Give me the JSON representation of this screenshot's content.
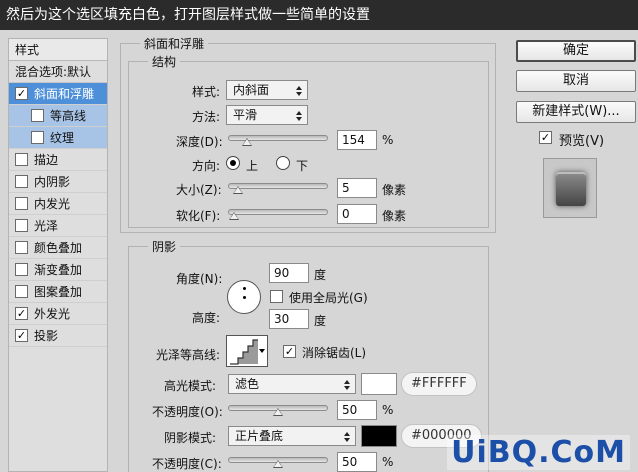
{
  "header": {
    "caption": "然后为这个选区填充白色，打开图层样式做一些简单的设置"
  },
  "sidebar": {
    "heading": "样式",
    "blend_options": "混合选项:默认",
    "items": [
      {
        "label": "斜面和浮雕",
        "checked": true,
        "selected": true
      },
      {
        "label": "等高线",
        "checked": false,
        "sub": true
      },
      {
        "label": "纹理",
        "checked": false,
        "sub": true
      },
      {
        "label": "描边",
        "checked": false
      },
      {
        "label": "内阴影",
        "checked": false
      },
      {
        "label": "内发光",
        "checked": false
      },
      {
        "label": "光泽",
        "checked": false
      },
      {
        "label": "颜色叠加",
        "checked": false
      },
      {
        "label": "渐变叠加",
        "checked": false
      },
      {
        "label": "图案叠加",
        "checked": false
      },
      {
        "label": "外发光",
        "checked": true
      },
      {
        "label": "投影",
        "checked": true
      }
    ]
  },
  "bevel": {
    "title": "斜面和浮雕",
    "structure_title": "结构",
    "style_label": "样式:",
    "style_value": "内斜面",
    "technique_label": "方法:",
    "technique_value": "平滑",
    "depth_label": "深度(D):",
    "depth_value": "154",
    "depth_unit": "%",
    "depth_level": 0.15,
    "direction_label": "方向:",
    "direction_up": "上",
    "direction_down": "下",
    "size_label": "大小(Z):",
    "size_value": "5",
    "size_unit": "像素",
    "size_level": 0.05,
    "soften_label": "软化(F):",
    "soften_value": "0",
    "soften_unit": "像素",
    "soften_level": 0.0
  },
  "shading": {
    "title": "阴影",
    "angle_label": "角度(N):",
    "angle_value": "90",
    "angle_unit": "度",
    "global_light_label": "使用全局光(G)",
    "altitude_label": "高度:",
    "altitude_value": "30",
    "altitude_unit": "度",
    "gloss_contour_label": "光泽等高线:",
    "anti_alias_label": "消除锯齿(L)",
    "highlight_mode_label": "高光模式:",
    "highlight_mode_value": "滤色",
    "highlight_color": "#FFFFFF",
    "highlight_hex": "#FFFFFF",
    "highlight_opacity_label": "不透明度(O):",
    "highlight_opacity_value": "50",
    "highlight_opacity_unit": "%",
    "highlight_opacity_level": 0.5,
    "shadow_mode_label": "阴影模式:",
    "shadow_mode_value": "正片叠底",
    "shadow_color": "#000000",
    "shadow_hex": "#000000",
    "shadow_opacity_label": "不透明度(C):",
    "shadow_opacity_value": "50",
    "shadow_opacity_unit": "%",
    "shadow_opacity_level": 0.5
  },
  "actions": {
    "ok": "确定",
    "cancel": "取消",
    "new_style": "新建样式(W)...",
    "preview": "预览(V)"
  },
  "watermark": "UiBQ.CoM"
}
